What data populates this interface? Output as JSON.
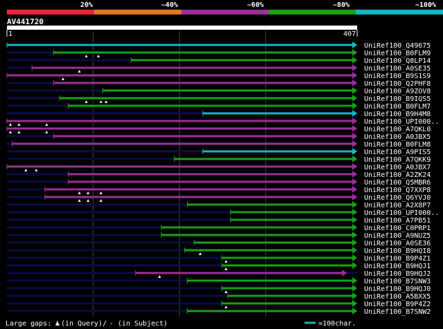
{
  "title": "AV441720",
  "scale": {
    "start_label": "1",
    "end_label": "407",
    "query_length": 407
  },
  "legend": {
    "bands": [
      {
        "label": "",
        "color": "#e8283a"
      },
      {
        "label": "20%",
        "color": "#e07a1f"
      },
      {
        "label": "~40%",
        "color": "#9c2f9c"
      },
      {
        "label": "~60%",
        "color": "#17a317"
      },
      {
        "label": "~80%",
        "color": "#14b8c2"
      },
      {
        "label": "~100%",
        "color": ""
      }
    ]
  },
  "colors": {
    "purple": "#9c2f9c",
    "green": "#17a317",
    "cyan": "#14b8c2",
    "navy": "#0b0b4a",
    "gap_marker": "#ffffff",
    "grid": "#444444"
  },
  "hits": [
    {
      "label": "UniRef100_Q49675",
      "start": 1,
      "end": 407,
      "color": "cyan",
      "marks": []
    },
    {
      "label": "UniRef100_B0FLM9",
      "start": 55,
      "end": 407,
      "color": "green",
      "marks": [
        93,
        107
      ]
    },
    {
      "label": "UniRef100_Q8LP14",
      "start": 145,
      "end": 407,
      "color": "green",
      "marks": []
    },
    {
      "label": "UniRef100_A0SE35",
      "start": 30,
      "end": 407,
      "color": "purple",
      "marks": [
        85
      ]
    },
    {
      "label": "UniRef100_B9S1S9",
      "start": 1,
      "end": 407,
      "color": "purple",
      "marks": [
        66
      ]
    },
    {
      "label": "UniRef100_Q2PHF8",
      "start": 55,
      "end": 407,
      "color": "purple",
      "marks": []
    },
    {
      "label": "UniRef100_A9ZOV8",
      "start": 112,
      "end": 407,
      "color": "green",
      "marks": []
    },
    {
      "label": "UniRef100_B9IQS5",
      "start": 62,
      "end": 407,
      "color": "green",
      "marks": [
        93,
        110,
        116
      ]
    },
    {
      "label": "UniRef100_B0FLM7",
      "start": 72,
      "end": 407,
      "color": "green",
      "marks": []
    },
    {
      "label": "UniRef100_B9H4M8",
      "start": 228,
      "end": 407,
      "color": "cyan",
      "marks": []
    },
    {
      "label": "UniRef100_UPI000..",
      "start": 1,
      "end": 407,
      "color": "purple",
      "marks": [
        5,
        15,
        47
      ]
    },
    {
      "label": "UniRef100_A7QKL0",
      "start": 1,
      "end": 407,
      "color": "purple",
      "marks": [
        5,
        15,
        47
      ]
    },
    {
      "label": "UniRef100_A0JBX5",
      "start": 55,
      "end": 407,
      "color": "purple",
      "marks": []
    },
    {
      "label": "UniRef100_B0FLM8",
      "start": 7,
      "end": 407,
      "color": "purple",
      "marks": []
    },
    {
      "label": "UniRef100_A9PIS5",
      "start": 228,
      "end": 407,
      "color": "cyan",
      "marks": []
    },
    {
      "label": "UniRef100_A7QKK9",
      "start": 195,
      "end": 407,
      "color": "green",
      "marks": []
    },
    {
      "label": "UniRef100_A0JBX7",
      "start": 1,
      "end": 407,
      "color": "purple",
      "marks": [
        23,
        35
      ]
    },
    {
      "label": "UniRef100_A2ZK24",
      "start": 72,
      "end": 407,
      "color": "purple",
      "marks": []
    },
    {
      "label": "UniRef100_Q5MBR6",
      "start": 72,
      "end": 407,
      "color": "purple",
      "marks": []
    },
    {
      "label": "UniRef100_Q7XXP8",
      "start": 45,
      "end": 407,
      "color": "purple",
      "marks": [
        85,
        95,
        110
      ]
    },
    {
      "label": "UniRef100_Q6YVJ0",
      "start": 45,
      "end": 407,
      "color": "purple",
      "marks": [
        85,
        95,
        110
      ]
    },
    {
      "label": "UniRef100_A2X8P7",
      "start": 210,
      "end": 407,
      "color": "green",
      "marks": []
    },
    {
      "label": "UniRef100_UPI000..",
      "start": 260,
      "end": 407,
      "color": "green",
      "marks": []
    },
    {
      "label": "UniRef100_A7PB51",
      "start": 260,
      "end": 407,
      "color": "green",
      "marks": []
    },
    {
      "label": "UniRef100_C0PRP1",
      "start": 180,
      "end": 407,
      "color": "green",
      "marks": []
    },
    {
      "label": "UniRef100_A9NUZ5",
      "start": 180,
      "end": 407,
      "color": "green",
      "marks": []
    },
    {
      "label": "UniRef100_A0SE36",
      "start": 218,
      "end": 407,
      "color": "green",
      "marks": []
    },
    {
      "label": "UniRef100_B9HQI8",
      "start": 207,
      "end": 407,
      "color": "green",
      "marks": [
        225
      ]
    },
    {
      "label": "UniRef100_B9P4Z1",
      "start": 250,
      "end": 407,
      "color": "green",
      "marks": [
        255
      ]
    },
    {
      "label": "UniRef100_B9HQJ1",
      "start": 250,
      "end": 407,
      "color": "green",
      "marks": [
        255
      ]
    },
    {
      "label": "UniRef100_B9HQJ2",
      "start": 150,
      "end": 395,
      "color": "purple",
      "marks": [
        178
      ]
    },
    {
      "label": "UniRef100_B7SNW3",
      "start": 210,
      "end": 407,
      "color": "green",
      "marks": []
    },
    {
      "label": "UniRef100_B9HQJ0",
      "start": 250,
      "end": 407,
      "color": "green",
      "marks": [
        255
      ]
    },
    {
      "label": "UniRef100_A5BXX5",
      "start": 257,
      "end": 407,
      "color": "green",
      "marks": []
    },
    {
      "label": "UniRef100_B9P4Z2",
      "start": 250,
      "end": 407,
      "color": "green",
      "marks": [
        255
      ]
    },
    {
      "label": "UniRef100_B7SNW2",
      "start": 210,
      "end": 407,
      "color": "green",
      "marks": []
    }
  ],
  "footer": {
    "gaps_label": "Large gaps:",
    "query_note": "(in Query)/",
    "subject_note": "- (in Subject)",
    "scale_note": "=100char."
  }
}
